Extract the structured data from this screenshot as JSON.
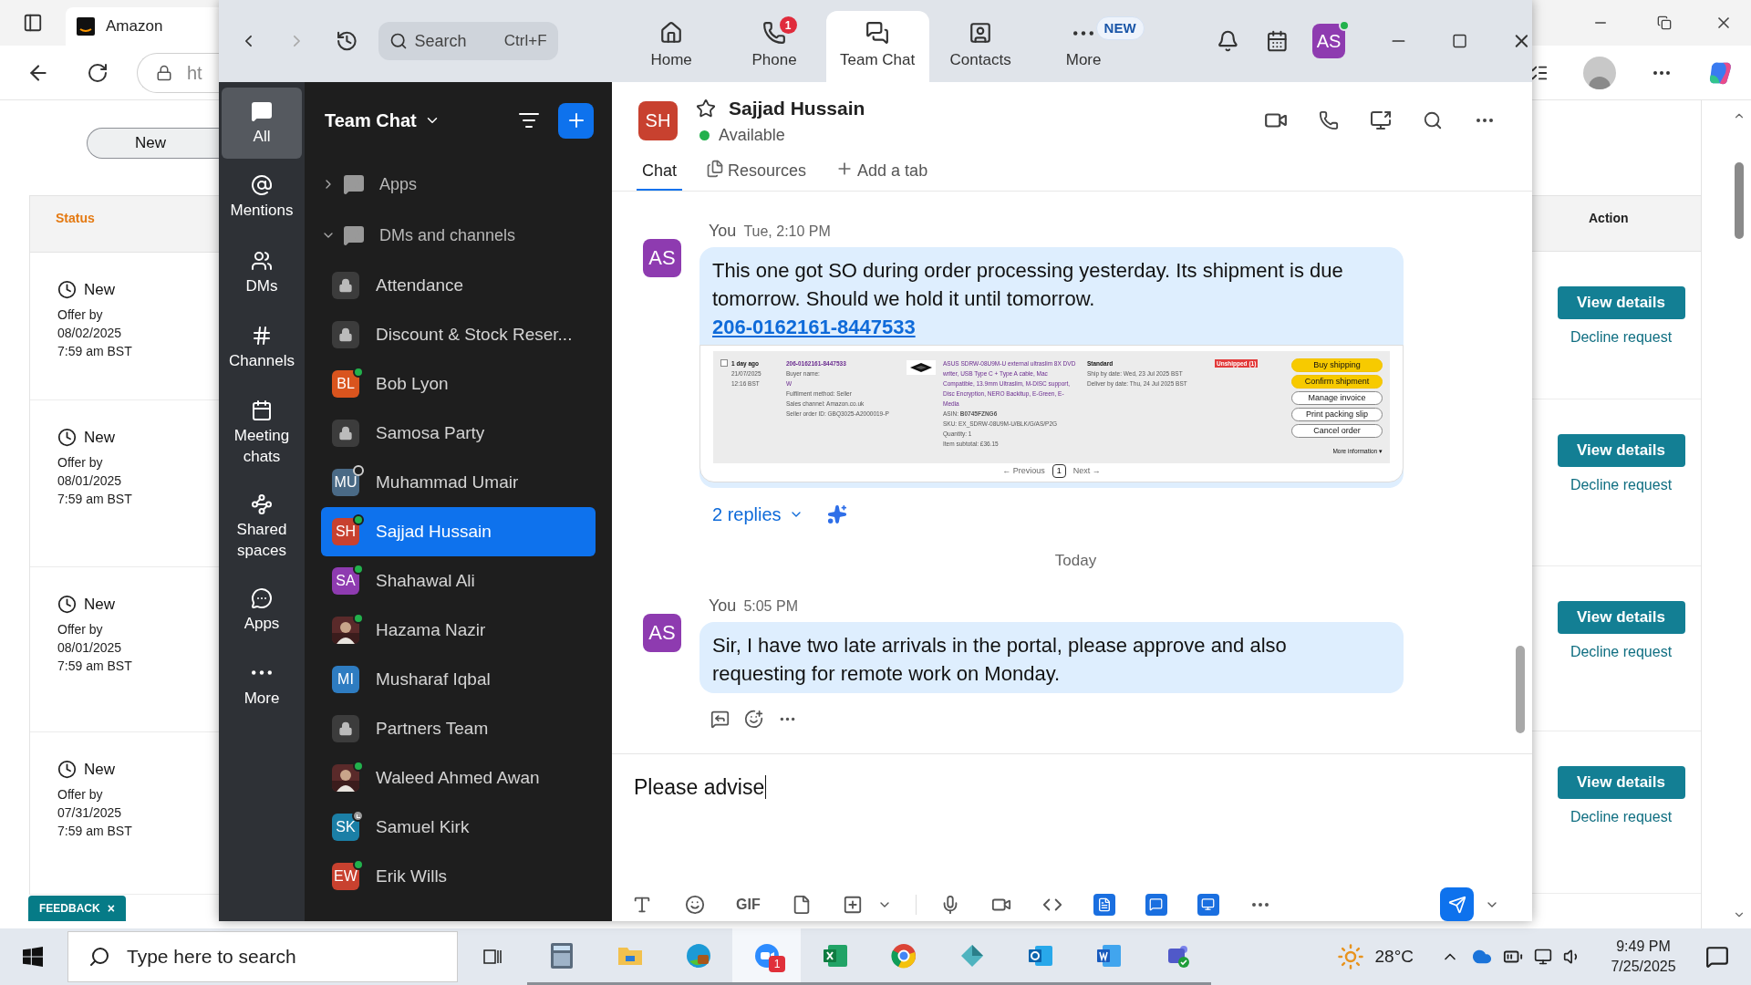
{
  "browser": {
    "tab_title": "Amazon",
    "address": "ht",
    "new_button": "New",
    "table": {
      "columns": [
        "Status",
        "Action"
      ],
      "rows": [
        {
          "status": "New",
          "offer": "Offer by",
          "date": "08/02/2025",
          "time": "7:59 am BST",
          "action": "View details",
          "link": "Decline request"
        },
        {
          "status": "New",
          "offer": "Offer by",
          "date": "08/01/2025",
          "time": "7:59 am BST",
          "action": "View details",
          "link": "Decline request"
        },
        {
          "status": "New",
          "offer": "Offer by",
          "date": "08/01/2025",
          "time": "7:59 am BST",
          "action": "View details",
          "link": "Decline request"
        },
        {
          "status": "New",
          "offer": "Offer by",
          "date": "07/31/2025",
          "time": "7:59 am BST",
          "action": "View details",
          "link": "Decline request"
        }
      ]
    },
    "feedback": "FEEDBACK",
    "feedback_close": "×"
  },
  "zoom": {
    "search": {
      "placeholder": "Search",
      "shortcut": "Ctrl+F"
    },
    "nav": [
      {
        "label": "Home",
        "selected": false
      },
      {
        "label": "Phone",
        "selected": false,
        "badge": "1"
      },
      {
        "label": "Team Chat",
        "selected": true
      },
      {
        "label": "Contacts",
        "selected": false
      },
      {
        "label": "More",
        "selected": false,
        "badge": "NEW"
      }
    ],
    "user": {
      "initials": "AS",
      "color": "#8e3bb0",
      "online": true
    },
    "rail": [
      {
        "label": "All",
        "selected": true
      },
      {
        "label": "Mentions",
        "selected": false
      },
      {
        "label": "DMs",
        "selected": false
      },
      {
        "label": "Channels",
        "selected": false
      },
      {
        "label": "Meeting chats",
        "selected": false
      },
      {
        "label": "Shared spaces",
        "selected": false
      },
      {
        "label": "Apps",
        "selected": false
      },
      {
        "label": "More",
        "selected": false
      }
    ],
    "sidebar": {
      "title": "Team Chat",
      "sections": [
        {
          "label": "Apps",
          "expanded": false
        },
        {
          "label": "DMs and channels",
          "expanded": true,
          "items": [
            {
              "name": "Attendance",
              "kind": "channel",
              "selected": false
            },
            {
              "name": "Discount & Stock Reser...",
              "kind": "channel",
              "selected": false
            },
            {
              "name": "Bob Lyon",
              "kind": "person",
              "initials": "BL",
              "color": "#d9541e",
              "online": true,
              "selected": false
            },
            {
              "name": "Samosa Party",
              "kind": "channel",
              "selected": false
            },
            {
              "name": "Muhammad Umair",
              "kind": "person",
              "initials": "MU",
              "color": "#4a6a86",
              "online": false,
              "offline": true,
              "selected": false
            },
            {
              "name": "Sajjad Hussain",
              "kind": "person",
              "initials": "SH",
              "color": "#c8412f",
              "online": true,
              "selected": true
            },
            {
              "name": "Shahawal Ali",
              "kind": "person",
              "initials": "SA",
              "color": "#8e3bb0",
              "online": true,
              "selected": false
            },
            {
              "name": "Hazama Nazir",
              "online": true,
              "selected": false
            },
            {
              "name": "Musharaf Iqbal",
              "kind": "person",
              "initials": "MI",
              "color": "#2e7cc1",
              "online": false,
              "selected": false
            },
            {
              "name": "Partners Team",
              "kind": "channel",
              "selected": false
            },
            {
              "name": "Waleed Ahmed Awan",
              "online": true,
              "selected": false
            },
            {
              "name": "Samuel Kirk",
              "kind": "person",
              "initials": "SK",
              "color": "#1b7fa6",
              "online": false,
              "away": true,
              "selected": false
            },
            {
              "name": "Erik Wills",
              "kind": "person",
              "initials": "EW",
              "color": "#c8412f",
              "online": true,
              "selected": false
            }
          ]
        }
      ]
    },
    "chat": {
      "initials": "SH",
      "color": "#c8412f",
      "name": "Sajjad Hussain",
      "favorite": false,
      "online": true,
      "status": "Available",
      "tabs": [
        {
          "label": "Chat",
          "selected": true
        },
        {
          "label": "Resources",
          "selected": false
        },
        {
          "label": "Add a tab",
          "selected": false
        }
      ],
      "timeline": [
        {
          "kind": "message",
          "sender": "You",
          "time": "Tue, 2:10 PM",
          "initials": "AS",
          "color": "#8e3bb0",
          "text": "This one got SO during order processing yesterday. Its shipment is due tomorrow. Should we hold it until tomorrow.",
          "link": "206-0162161-8447533",
          "attachment": {
            "checked": false,
            "age": "1 day ago",
            "date": "21/07/2025",
            "time": "12:16 BST",
            "order_id": "206-0162161-8447533",
            "buyer_label": "Buyer name:",
            "buyer": "W",
            "details": [
              "Fulfilment method: Seller",
              "Sales channel: Amazon.co.uk",
              "Seller order ID: GBQ3025-A2000019-P"
            ],
            "product": "ASUS SDRW-08U9M-U external ultraslim 8X DVD writer, USB Type C + Type A cable, Mac Compatible, 13.9mm Ultraslim, M-DISC support, Disc Encryption, NERO Backitup, E-Green, E-Media",
            "asin": "ASIN: **B0745FZNG6**",
            "product_details": [
              "SKU: EX_SDRW-08U9M-U/BLK/G/AS/P2G",
              "Quantity: 1",
              "Item subtotal: £36.15"
            ],
            "order_type": "Standard",
            "dates": [
              "Ship by date: Wed, 23 Jul 2025 BST",
              "Deliver by date: Thu, 24 Jul 2025 BST"
            ],
            "status": "Unshipped (1)",
            "actions": [
              {
                "label": "Buy shipping",
                "primary": true
              },
              {
                "label": "Confirm shipment",
                "primary": true
              },
              {
                "label": "Manage invoice",
                "primary": false
              },
              {
                "label": "Print packing slip",
                "primary": false
              },
              {
                "label": "Cancel order",
                "primary": false
              }
            ],
            "more": "More information ▾",
            "pagination": {
              "previous": "← Previous",
              "page": "1",
              "next": "Next →"
            }
          },
          "replies": "2 replies"
        },
        {
          "kind": "divider",
          "label": "Today"
        },
        {
          "kind": "message",
          "sender": "You",
          "time": "5:05 PM",
          "initials": "AS",
          "color": "#8e3bb0",
          "text": "Sir, I have two late arrivals in the portal, please approve and also requesting for remote work on Monday."
        }
      ],
      "composer": {
        "value": "Please advise",
        "gif": "GIF"
      }
    }
  },
  "taskbar": {
    "search_placeholder": "Type here to search",
    "apps": [
      {
        "selected": false
      },
      {
        "selected": false
      },
      {
        "selected": false
      },
      {
        "selected": true,
        "badge": "1"
      },
      {
        "selected": false
      },
      {
        "selected": false
      },
      {
        "selected": false
      },
      {
        "selected": false
      },
      {
        "selected": false
      },
      {
        "selected": false
      }
    ],
    "weather": "28°C",
    "time": "9:49 PM",
    "date": "7/25/2025"
  }
}
